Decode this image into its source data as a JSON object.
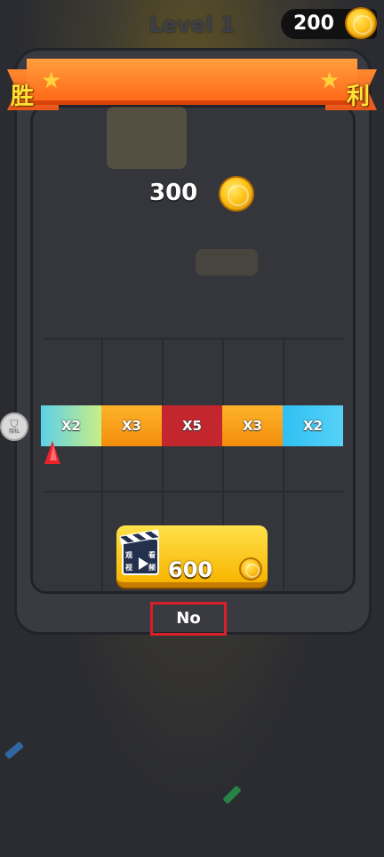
{
  "header": {
    "level_title": "Level 1",
    "coin_balance": "200"
  },
  "banner": {
    "left_char": "胜",
    "right_char": "利"
  },
  "reward": {
    "value": "300"
  },
  "multiplier_bar": {
    "segments": [
      {
        "label": "X2",
        "color": "#8fe0a8"
      },
      {
        "label": "X3",
        "color": "#f7a21b"
      },
      {
        "label": "X5",
        "color": "#c4262d"
      },
      {
        "label": "X3",
        "color": "#f7a21b"
      },
      {
        "label": "X2",
        "color": "#36c2f2"
      }
    ],
    "pointer_icon": "red-arrow-pointer"
  },
  "side_badge": {
    "label": "隐私"
  },
  "video_button": {
    "value": "600",
    "icon_text": [
      "观",
      "看",
      "视",
      "频"
    ]
  },
  "no_button": {
    "label": "No"
  },
  "colors": {
    "accent_orange": "#ff7a22",
    "button_yellow": "#f7b500",
    "highlight_red": "#d81f2a"
  }
}
